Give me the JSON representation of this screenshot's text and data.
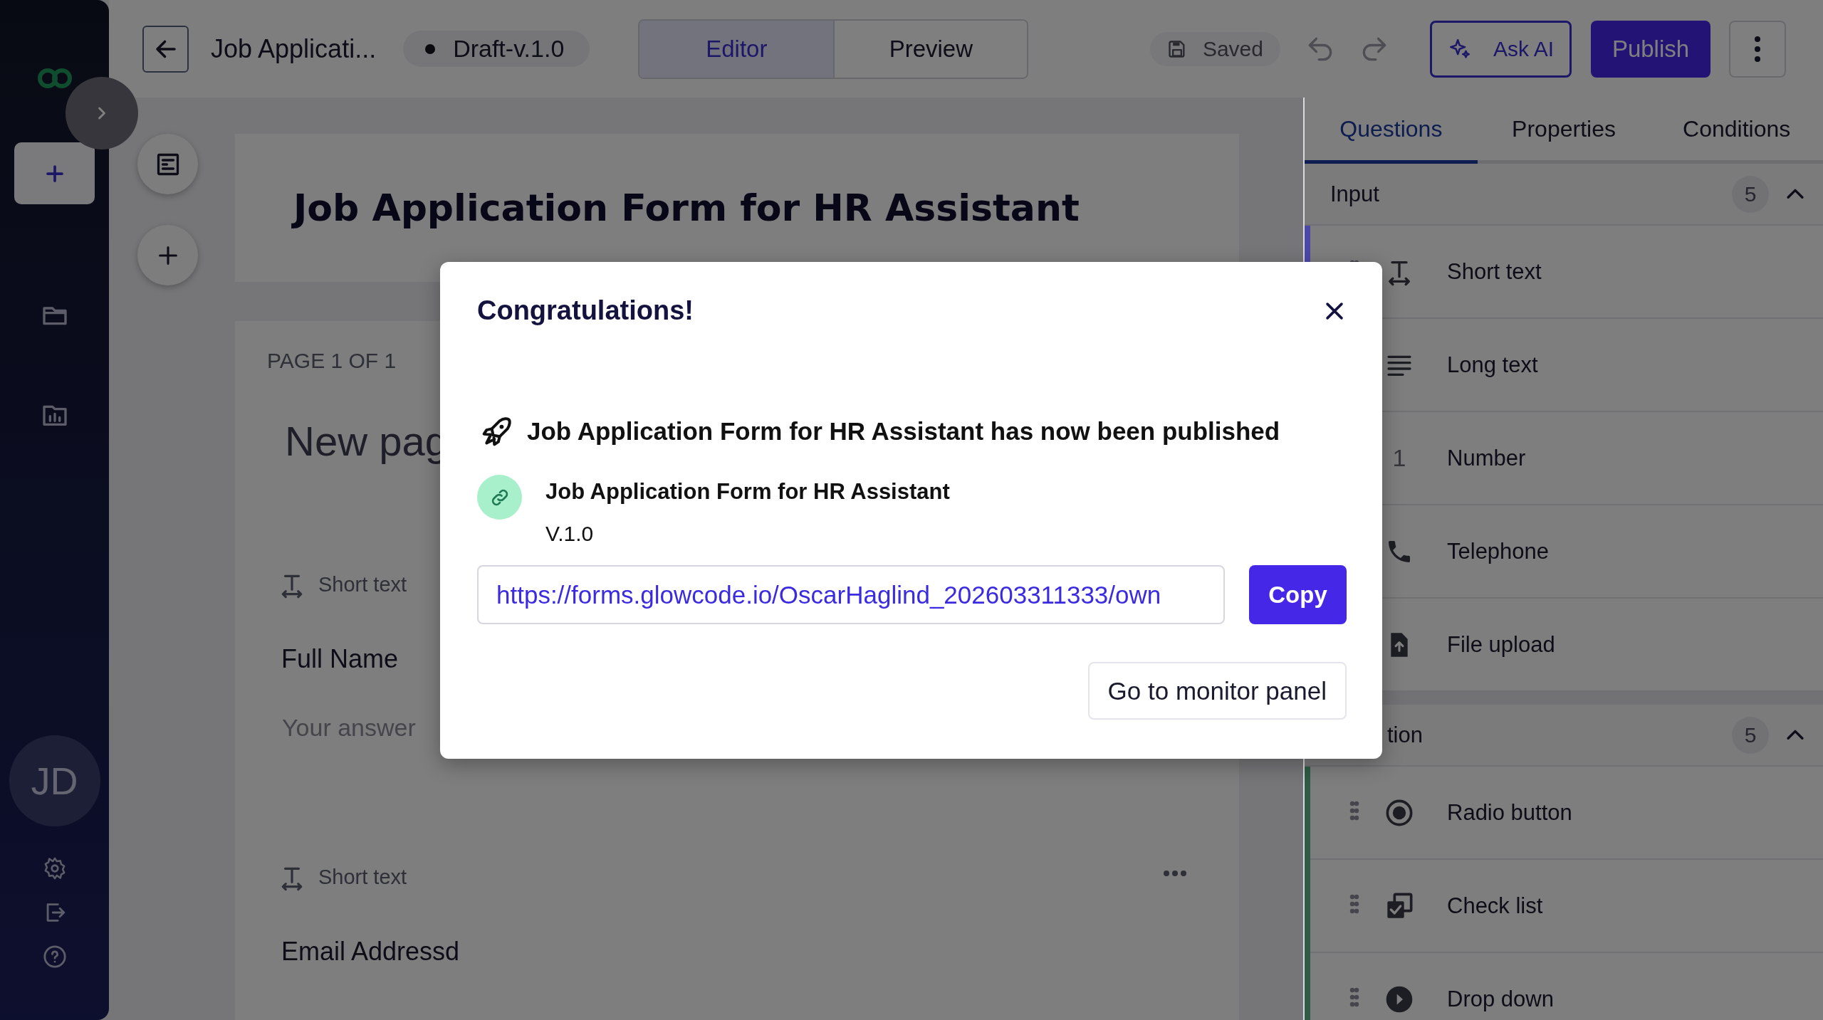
{
  "sidebar": {
    "avatar_initials": "JD"
  },
  "top_bar": {
    "title": "Job Applicati...",
    "status": "Draft-v.1.0",
    "view_tabs": [
      {
        "label": "Editor",
        "selected": true
      },
      {
        "label": "Preview",
        "selected": false
      }
    ],
    "save_status": "Saved",
    "ask_ai": "Ask AI",
    "publish": "Publish"
  },
  "form": {
    "title": "Job Application Form for HR Assistant",
    "page_label": "PAGE 1 OF 1",
    "page_title": "New pag",
    "questions": [
      {
        "type_label": "Short text",
        "title": "Full Name",
        "placeholder": "Your answer"
      },
      {
        "type_label": "Short text",
        "title": "Email Addressd"
      }
    ]
  },
  "panel": {
    "tabs": [
      {
        "label": "Questions",
        "selected": true
      },
      {
        "label": "Properties",
        "selected": false
      },
      {
        "label": "Conditions",
        "selected": false
      }
    ],
    "sections": [
      {
        "title": "Input",
        "count": "5",
        "expanded": true,
        "color": "#4c48a8",
        "items": [
          {
            "kind": "short",
            "label": "Short text",
            "handle": true
          },
          {
            "kind": "long",
            "label": "Long text",
            "handle": false
          },
          {
            "kind": "number",
            "label": "Number",
            "glyph": "1",
            "handle": false
          },
          {
            "kind": "phone",
            "label": "Telephone",
            "handle": false
          },
          {
            "kind": "file",
            "label": "File upload",
            "handle": false
          }
        ]
      },
      {
        "title": "tion",
        "count": "5",
        "expanded": true,
        "color": "#2e5c46",
        "items": [
          {
            "kind": "radio",
            "label": "Radio button",
            "handle": true
          },
          {
            "kind": "checklist",
            "label": "Check list",
            "handle": true
          },
          {
            "kind": "dropdown",
            "label": "Drop down",
            "handle": true
          }
        ]
      }
    ]
  },
  "dialog": {
    "title": "Congratulations!",
    "message": "Job Application Form for HR Assistant has now been published",
    "form_name": "Job Application Form for HR Assistant",
    "version": "V.1.0",
    "url": "https://forms.glowcode.io/OscarHaglind_202603311333/own",
    "copy": "Copy",
    "monitor": "Go to monitor panel"
  }
}
